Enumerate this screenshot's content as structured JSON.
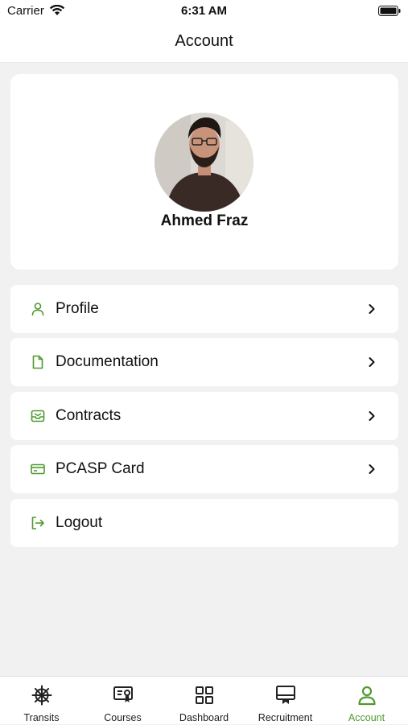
{
  "status_bar": {
    "carrier": "Carrier",
    "time": "6:31 AM"
  },
  "header": {
    "title": "Account"
  },
  "profile": {
    "name": "Ahmed Fraz"
  },
  "menu": [
    {
      "label": "Profile",
      "icon": "person-icon"
    },
    {
      "label": "Documentation",
      "icon": "document-icon"
    },
    {
      "label": "Contracts",
      "icon": "inbox-icon"
    },
    {
      "label": "PCASP Card",
      "icon": "card-icon"
    },
    {
      "label": "Logout",
      "icon": "logout-icon"
    }
  ],
  "tabs": [
    {
      "label": "Transits",
      "icon": "ship-wheel-icon"
    },
    {
      "label": "Courses",
      "icon": "certificate-icon"
    },
    {
      "label": "Dashboard",
      "icon": "grid-icon"
    },
    {
      "label": "Recruitment",
      "icon": "presentation-icon"
    },
    {
      "label": "Account",
      "icon": "person-icon",
      "active": true
    }
  ],
  "colors": {
    "accent": "#4f9a2f",
    "background": "#f1f1f2",
    "card": "#ffffff"
  }
}
